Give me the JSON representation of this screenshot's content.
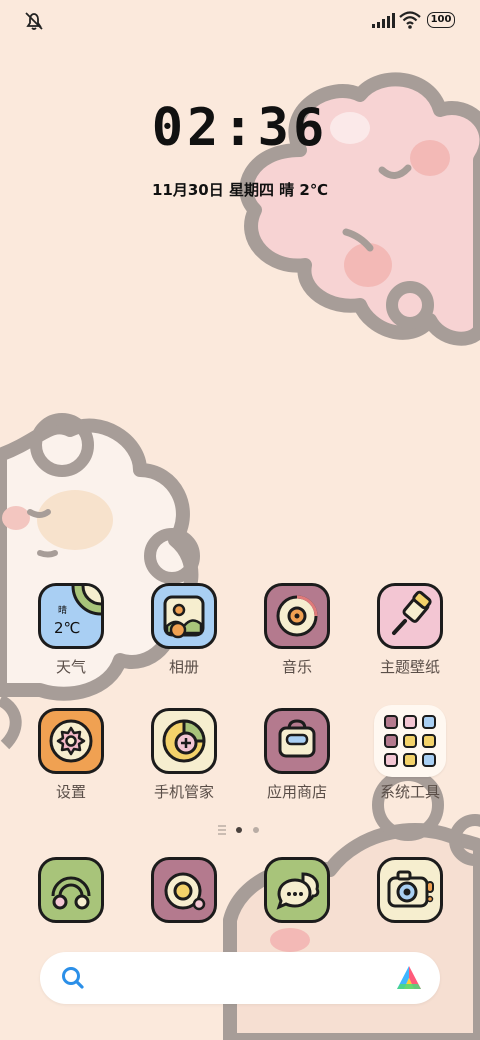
{
  "status_bar": {
    "icons": [
      "mute-icon",
      "signal-icon",
      "wifi-icon",
      "battery-icon"
    ],
    "battery_level": "100"
  },
  "clock": {
    "time": "02:36",
    "date": "11月30日  星期四  晴  2℃"
  },
  "apps": [
    {
      "label": "天气",
      "icon": "weather-icon",
      "weather_condition": "晴",
      "weather_temp": "2℃",
      "color": "#a9cff3"
    },
    {
      "label": "相册",
      "icon": "gallery-icon",
      "color": "#a9cff3"
    },
    {
      "label": "音乐",
      "icon": "music-icon",
      "color": "#b47a8e"
    },
    {
      "label": "主题壁纸",
      "icon": "theme-brush-icon",
      "color": "#f3c6d3"
    },
    {
      "label": "设置",
      "icon": "settings-gear-icon",
      "color": "#f0a152"
    },
    {
      "label": "手机管家",
      "icon": "phone-manager-icon",
      "color": "#f6eecf"
    },
    {
      "label": "应用商店",
      "icon": "app-store-bag-icon",
      "color": "#b47a8e"
    },
    {
      "label": "系统工具",
      "icon": "folder-icon"
    }
  ],
  "dock": [
    {
      "name": "phone-dock-app",
      "icon": "rainbow-icon",
      "color": "#a8c47a"
    },
    {
      "name": "browser-dock-app",
      "icon": "egg-icon",
      "color": "#b47a8e"
    },
    {
      "name": "messages-dock-app",
      "icon": "chat-bubble-icon",
      "color": "#a8c47a"
    },
    {
      "name": "camera-dock-app",
      "icon": "camera-icon",
      "color": "#f6eecf"
    }
  ],
  "page_indicator": {
    "pages": 2,
    "current": 1
  },
  "search": {
    "icon": "search-icon",
    "logo": "assistant-logo-icon"
  }
}
